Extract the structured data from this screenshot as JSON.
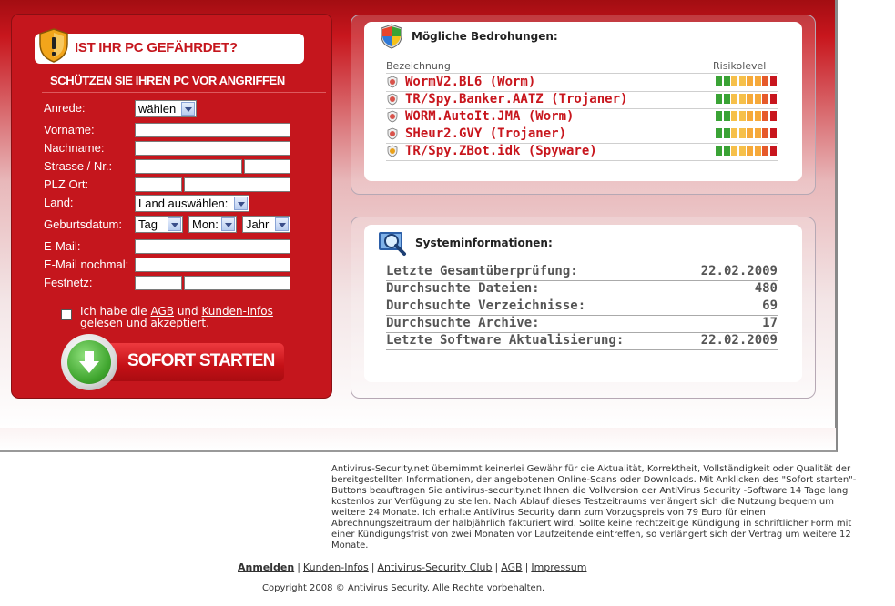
{
  "colors": {
    "brand_red": "#c5161d",
    "threat_red": "#c8161d",
    "text_grey": "#555555"
  },
  "form": {
    "warning_title": "IST IHR PC GEFÄHRDET?",
    "subtitle": "SCHÜTZEN SIE IHREN PC VOR ANGRIFFEN",
    "anrede_label": "Anrede:",
    "anrede_value": "wählen",
    "vorname_label": "Vorname:",
    "nachname_label": "Nachname:",
    "strasse_label": "Strasse / Nr.:",
    "plz_label": "PLZ Ort:",
    "land_label": "Land:",
    "land_value": "Land auswählen:",
    "geburtsdatum_label": "Geburtsdatum:",
    "tag_value": "Tag",
    "monat_value": "Mon:",
    "jahr_value": "Jahr",
    "email_label": "E-Mail:",
    "email_repeat_label": "E-Mail nochmal:",
    "festnetz_label": "Festnetz:",
    "agb_prefix": "Ich habe die ",
    "agb_link": "AGB",
    "agb_and": " und ",
    "kunden_link": "Kunden-Infos",
    "agb_suffix": "gelesen und akzeptiert.",
    "start_button": "SOFORT STARTEN"
  },
  "threats": {
    "title": "Mögliche Bedrohungen:",
    "col_name": "Bezeichnung",
    "col_risk": "Risikolevel",
    "rows": [
      {
        "name": "WormV2.BL6 (Worm)",
        "icon": "worm-icon",
        "risk_level": 8
      },
      {
        "name": "TR/Spy.Banker.AATZ (Trojaner)",
        "icon": "trojan-icon",
        "risk_level": 8
      },
      {
        "name": "WORM.AutoIt.JMA (Worm)",
        "icon": "worm-icon",
        "risk_level": 8
      },
      {
        "name": "SHeur2.GVY (Trojaner)",
        "icon": "trojan-icon",
        "risk_level": 8
      },
      {
        "name": "TR/Spy.ZBot.idk (Spyware)",
        "icon": "spyware-icon",
        "risk_level": 8
      }
    ]
  },
  "system": {
    "title": "Systeminformationen:",
    "rows": [
      {
        "key": "Letzte Gesamtüberprüfung:",
        "value": "22.02.2009"
      },
      {
        "key": "Durchsuchte Dateien:",
        "value": "480"
      },
      {
        "key": "Durchsuchte Verzeichnisse:",
        "value": "69"
      },
      {
        "key": "Durchsuchte Archive:",
        "value": "17"
      },
      {
        "key": "Letzte Software Aktualisierung:",
        "value": "22.02.2009"
      }
    ]
  },
  "disclaimer": "Antivirus-Security.net übernimmt keinerlei Gewähr für die Aktualität, Korrektheit, Vollständigkeit oder Qualität der bereitgestellten Informationen, der angebotenen Online-Scans oder Downloads. Mit Anklicken des \"Sofort starten\"-Buttons beauftragen Sie antivirus-security.net Ihnen die Vollversion der AntiVirus Security -Software 14 Tage lang kostenlos zur Verfügung zu stellen. Nach Ablauf dieses Testzeitraums verlängert sich die Nutzung bequem um weitere 24 Monate. Ich erhalte AntiVirus Security dann zum Vorzugspreis von 79 Euro für einen Abrechnungszeitraum der halbjährlich fakturiert wird. Sollte keine rechtzeitige Kündigung in schriftlicher Form mit einer Kündigungsfrist von zwei Monaten vor Laufzeitende eintreffen, so verlängert sich der Vertrag um weitere 12 Monate.",
  "footer": {
    "links": [
      "Anmelden",
      "Kunden-Infos",
      "Antivirus-Security Club",
      "AGB",
      "Impressum"
    ],
    "separator": "|",
    "copyright": "Copyright 2008 © Antivirus Security. Alle Rechte vorbehalten."
  }
}
